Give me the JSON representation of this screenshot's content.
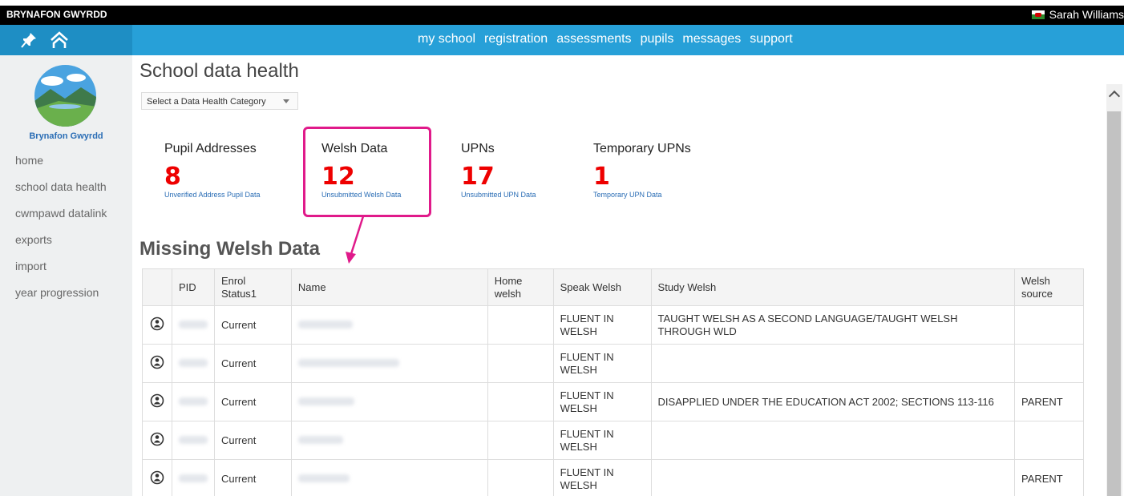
{
  "topbar": {
    "school": "BRYNAFON GWYRDD",
    "user": "Sarah Williams"
  },
  "nav": {
    "links": [
      "my school",
      "registration",
      "assessments",
      "pupils",
      "messages",
      "support"
    ]
  },
  "sidebar": {
    "logo_name": "Brynafon Gwyrdd",
    "items": [
      "home",
      "school data health",
      "cwmpawd datalink",
      "exports",
      "import",
      "year progression"
    ]
  },
  "main": {
    "title": "School data health",
    "select_value": "Select a Data Health Category",
    "stats": [
      {
        "title": "Pupil Addresses",
        "count": "8",
        "sub": "Unverified Address Pupil Data"
      },
      {
        "title": "Welsh Data",
        "count": "12",
        "sub": "Unsubmitted Welsh Data"
      },
      {
        "title": "UPNs",
        "count": "17",
        "sub": "Unsubmitted UPN Data"
      },
      {
        "title": "Temporary UPNs",
        "count": "1",
        "sub": "Temporary UPN Data"
      }
    ],
    "section_title": "Missing Welsh Data"
  },
  "table": {
    "headers": {
      "pid": "PID",
      "enrol_1": "Enrol",
      "enrol_2": "Status1",
      "name": "Name",
      "home_1": "Home",
      "home_2": "welsh",
      "speak": "Speak Welsh",
      "study": "Study Welsh",
      "source_1": "Welsh",
      "source_2": "source"
    },
    "rows": [
      {
        "status": "Current",
        "speak_1": "FLUENT IN",
        "speak_2": "WELSH",
        "study": "TAUGHT WELSH AS A SECOND LANGUAGE/TAUGHT WELSH THROUGH WLD",
        "source": ""
      },
      {
        "status": "Current",
        "speak_1": "FLUENT IN",
        "speak_2": "WELSH",
        "study": "",
        "source": ""
      },
      {
        "status": "Current",
        "speak_1": "FLUENT IN",
        "speak_2": "WELSH",
        "study": "DISAPPLIED UNDER THE EDUCATION ACT 2002; SECTIONS 113-116",
        "source": "PARENT"
      },
      {
        "status": "Current",
        "speak_1": "FLUENT IN",
        "speak_2": "WELSH",
        "study": "",
        "source": ""
      },
      {
        "status": "Current",
        "speak_1": "FLUENT IN",
        "speak_2": "WELSH",
        "study": "",
        "source": "PARENT"
      }
    ]
  },
  "colors": {
    "nav": "#27a0d8",
    "count": "#e00000",
    "highlight": "#e01a8a",
    "link": "#2a6db5"
  }
}
